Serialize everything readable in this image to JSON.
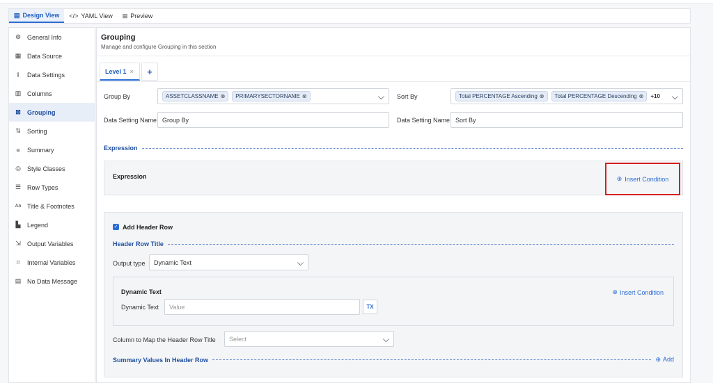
{
  "tabs": [
    {
      "label": "Design View",
      "icon": "document-icon"
    },
    {
      "label": "YAML View",
      "icon": "code-icon"
    },
    {
      "label": "Preview",
      "icon": "preview-icon"
    }
  ],
  "sidebar": {
    "items": [
      {
        "label": "General Info",
        "icon": "gear-icon"
      },
      {
        "label": "Data Source",
        "icon": "database-icon"
      },
      {
        "label": "Data Settings",
        "icon": "data-settings-icon"
      },
      {
        "label": "Columns",
        "icon": "columns-icon"
      },
      {
        "label": "Grouping",
        "icon": "grouping-icon"
      },
      {
        "label": "Sorting",
        "icon": "sort-icon"
      },
      {
        "label": "Summary",
        "icon": "summary-icon"
      },
      {
        "label": "Style Classes",
        "icon": "palette-icon"
      },
      {
        "label": "Row Types",
        "icon": "row-types-icon"
      },
      {
        "label": "Title & Footnotes",
        "icon": "text-icon"
      },
      {
        "label": "Legend",
        "icon": "legend-icon"
      },
      {
        "label": "Output Variables",
        "icon": "output-icon"
      },
      {
        "label": "Internal Variables",
        "icon": "variables-icon"
      },
      {
        "label": "No Data Message",
        "icon": "message-icon"
      }
    ],
    "active_index": 4
  },
  "section": {
    "title": "Grouping",
    "subtitle": "Manage and configure Grouping in this section"
  },
  "level_tab": {
    "label": "Level 1",
    "close": "×",
    "add": "+"
  },
  "group_by": {
    "label": "Group By",
    "chips": [
      "ASSETCLASSNAME",
      "PRIMARYSECTORNAME"
    ]
  },
  "sort_by": {
    "label": "Sort By",
    "chips": [
      "Total PERCENTAGE Ascending",
      "Total PERCENTAGE Descending"
    ],
    "more": "+10"
  },
  "data_setting_left": {
    "label": "Data Setting Name",
    "value": "Group By"
  },
  "data_setting_right": {
    "label": "Data Setting Name",
    "value": "Sort By"
  },
  "expression": {
    "section_label": "Expression",
    "box_label": "Expression",
    "insert_label": "Insert Condition"
  },
  "header_row": {
    "checkbox_label": "Add Header Row",
    "checked": true,
    "title_section": "Header Row Title",
    "output_type_label": "Output type",
    "output_type_value": "Dynamic Text",
    "dynamic_text": {
      "title": "Dynamic Text",
      "insert_label": "Insert Condition",
      "field_label": "Dynamic Text",
      "field_value": "Value",
      "tx_label": "TX"
    },
    "column_map_label": "Column to Map the Header Row Title",
    "column_map_placeholder": "Select",
    "summary_section": "Summary Values In Header Row",
    "add_label": "Add"
  },
  "colors": {
    "accent": "#2b6cd4",
    "highlight": "#d61f1f"
  }
}
